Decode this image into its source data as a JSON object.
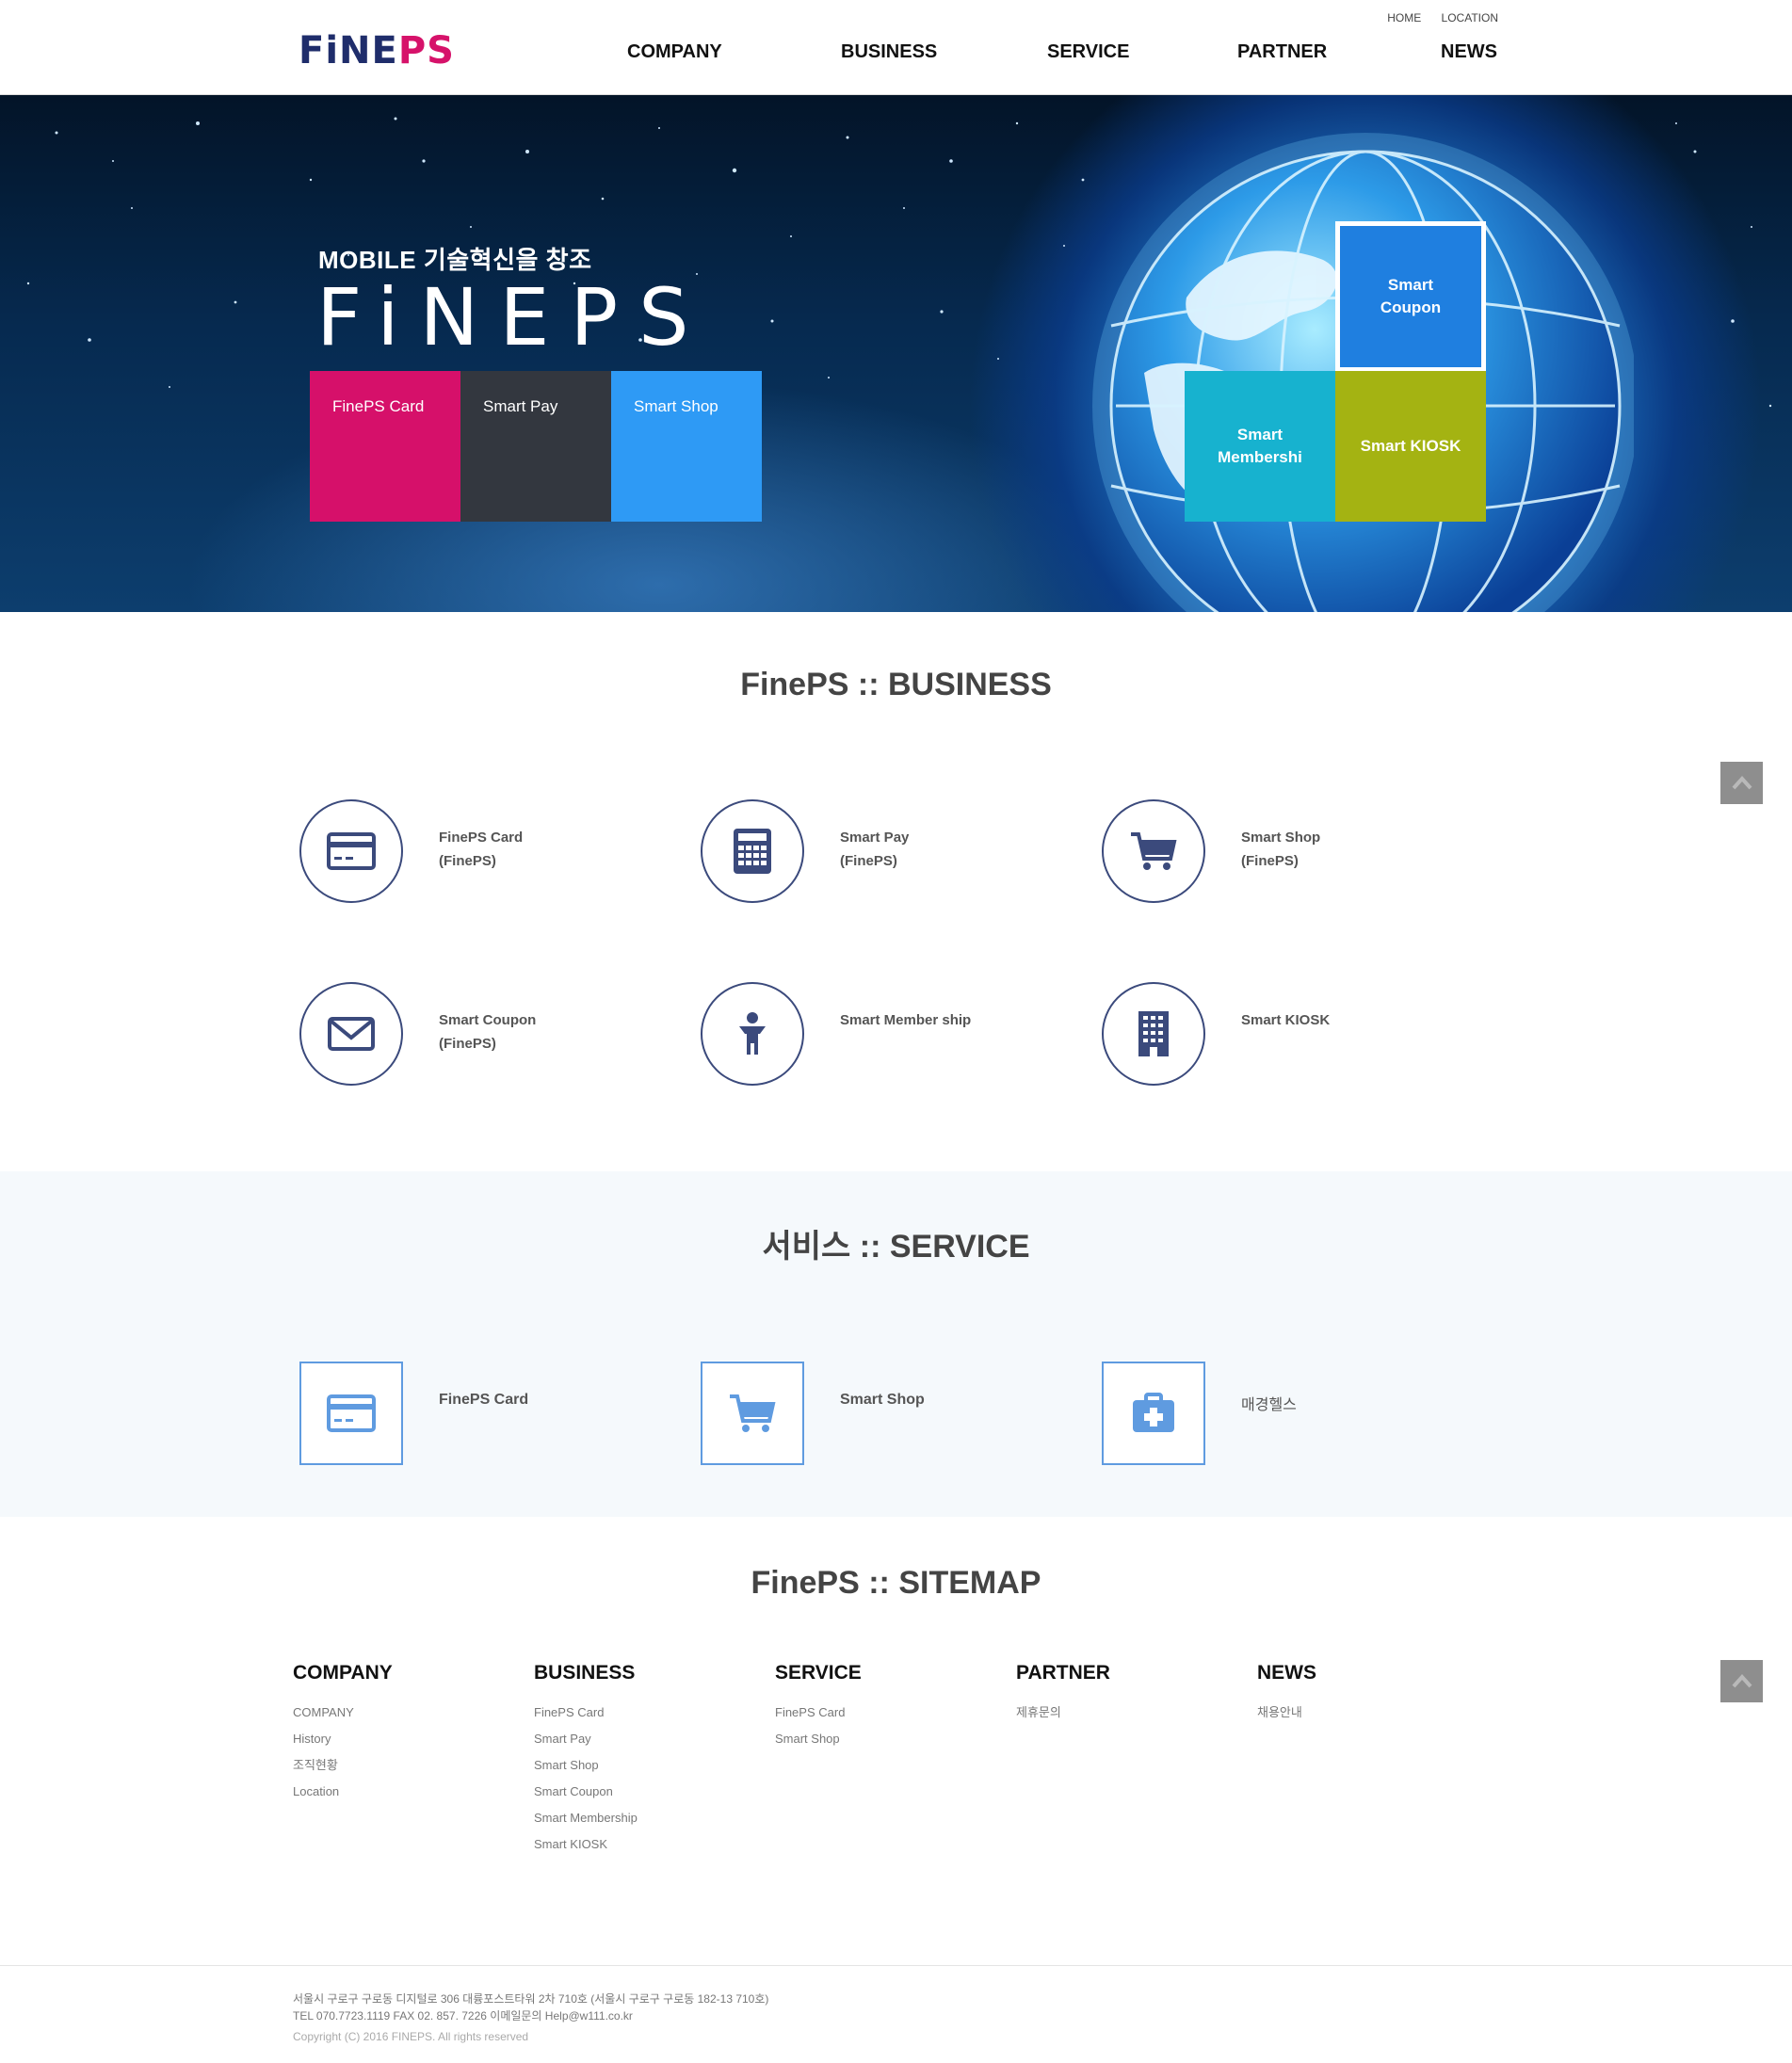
{
  "header": {
    "logo_part1": "FiNE",
    "logo_part2": "PS",
    "util_links": [
      "HOME",
      "LOCATION"
    ],
    "nav": [
      "COMPANY",
      "BUSINESS",
      "SERVICE",
      "PARTNER",
      "NEWS"
    ]
  },
  "hero": {
    "subtitle": "MOBILE 기술혁신을 창조",
    "title": "FiNEPS",
    "boxes": [
      {
        "label": "FinePS Card",
        "color": "#d6106a"
      },
      {
        "label": "Smart Pay",
        "color": "#33373f"
      },
      {
        "label": "Smart Shop",
        "color": "#2e9af5"
      }
    ],
    "tiles": [
      {
        "label": "Smart Coupon",
        "color": "#1f7fe0"
      },
      {
        "label": "Smart Membershi",
        "color": "#17b2cf"
      },
      {
        "label": "Smart KIOSK",
        "color": "#a4b312"
      }
    ]
  },
  "business": {
    "title": "FinePS :: BUSINESS",
    "items": [
      {
        "name": "FinePS Card",
        "sub": "(FinePS)",
        "icon": "credit-card-icon"
      },
      {
        "name": "Smart Pay",
        "sub": "(FinePS)",
        "icon": "calculator-icon"
      },
      {
        "name": "Smart Shop",
        "sub": "(FinePS)",
        "icon": "cart-icon"
      },
      {
        "name": "Smart Coupon",
        "sub": "(FinePS)",
        "icon": "envelope-icon"
      },
      {
        "name": "Smart Member ship",
        "sub": "",
        "icon": "person-icon"
      },
      {
        "name": "Smart KIOSK",
        "sub": "",
        "icon": "building-icon"
      }
    ]
  },
  "service": {
    "title": "서비스 :: SERVICE",
    "items": [
      {
        "name": "FinePS Card",
        "icon": "credit-card-icon"
      },
      {
        "name": "Smart Shop",
        "icon": "cart-icon"
      },
      {
        "name": "매경헬스",
        "icon": "medical-kit-icon"
      }
    ]
  },
  "sitemap": {
    "title": "FinePS :: SITEMAP",
    "columns": [
      {
        "head": "COMPANY",
        "links": [
          "COMPANY",
          "History",
          "조직현황",
          "Location"
        ]
      },
      {
        "head": "BUSINESS",
        "links": [
          "FinePS Card",
          "Smart Pay",
          "Smart Shop",
          "Smart Coupon",
          "Smart Membership",
          "Smart KIOSK"
        ]
      },
      {
        "head": "SERVICE",
        "links": [
          "FinePS Card",
          "Smart Shop"
        ]
      },
      {
        "head": "PARTNER",
        "links": [
          "제휴문의"
        ]
      },
      {
        "head": "NEWS",
        "links": [
          "채용안내"
        ]
      }
    ]
  },
  "footer": {
    "address": "서울시 구로구 구로동 디지털로 306 대륭포스트타워 2차 710호 (서울시 구로구 구로동 182-13 710호)",
    "contact": "TEL 070.7723.1119 FAX 02. 857. 7226 이메일문의 Help@w111.co.kr",
    "copyright": "Copyright (C) 2016 FINEPS. All rights reserved"
  }
}
